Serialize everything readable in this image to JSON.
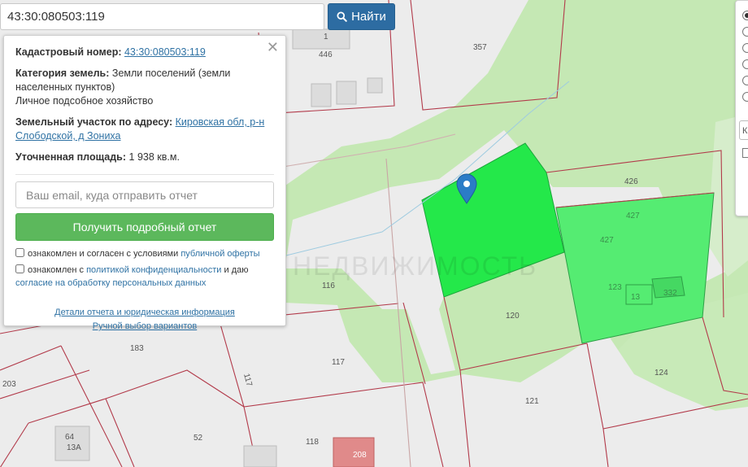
{
  "search": {
    "value": "43:30:080503:119",
    "button_label": "Найти"
  },
  "info": {
    "cad_label": "Кадастровый номер:",
    "cad_value": "43:30:080503:119",
    "cat_label": "Категория земель:",
    "cat_value": "Земли поселений (земли населенных пунктов)",
    "usage": "Личное подсобное хозяйство",
    "addr_label": "Земельный участок по адресу:",
    "addr_value": "Кировская обл, р-н Слободской, д Зониха",
    "area_label": "Уточненная площадь:",
    "area_value": "1 938 кв.м.",
    "email_placeholder": "Ваш email, куда отправить отчет",
    "report_button": "Получить подробный отчет",
    "check1_text": "ознакомлен и согласен с условиями",
    "check1_link": "публичной оферты",
    "check2_text": "ознакомлен с",
    "check2_link": "политикой конфиденциальности",
    "check2_mid": "и даю",
    "check2_link2": "согласие на обработку персональных данных",
    "details_link": "Детали отчета и юридическая информация",
    "manual_link": "Ручной выбор вариантов"
  },
  "right_panel": {
    "select_value": "К"
  },
  "map": {
    "parcels": [
      "446",
      "1",
      "357",
      "426",
      "427",
      "427",
      "123",
      "13",
      "332",
      "116",
      "120",
      "183",
      "117",
      "117",
      "124",
      "121",
      "203",
      "52",
      "118",
      "208",
      "64",
      "13А"
    ],
    "watermark": "НЕДВИЖИМОСТЬ",
    "colors": {
      "forest": "#c5e8b4",
      "selected": "#24e84a",
      "neighbor": "#55ec72",
      "boundary": "#b23a4a"
    }
  }
}
